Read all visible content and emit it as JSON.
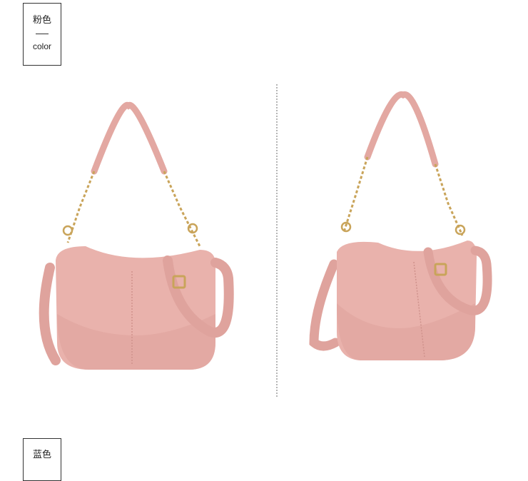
{
  "swatches": [
    {
      "name_cn": "粉色",
      "name_en": "color"
    },
    {
      "name_cn": "蓝色"
    }
  ],
  "colors": {
    "bag_pink": "#e9b2ac",
    "bag_shadow": "#cf928c",
    "hardware_gold": "#c9a45a",
    "divider": "#b5b5b5"
  },
  "images": [
    {
      "name": "handbag-front-view"
    },
    {
      "name": "handbag-angled-view"
    }
  ]
}
